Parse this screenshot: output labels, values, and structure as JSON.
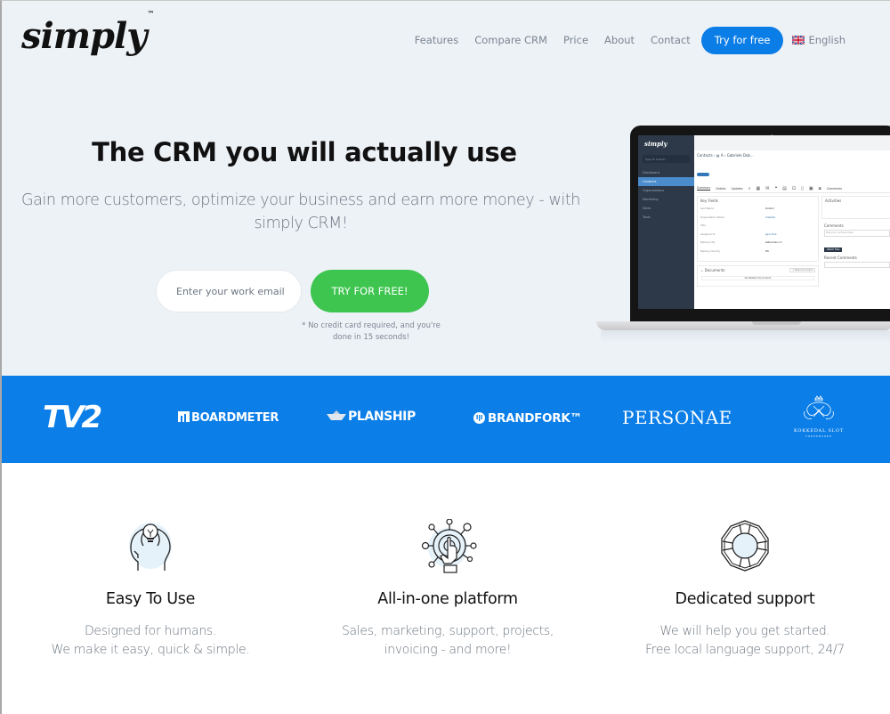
{
  "header": {
    "logo_text": "simply",
    "logo_tm": "™",
    "nav": [
      {
        "label": "Features"
      },
      {
        "label": "Compare CRM"
      },
      {
        "label": "Price"
      },
      {
        "label": "About"
      },
      {
        "label": "Contact"
      }
    ],
    "try_button": "Try for free",
    "language": {
      "label": "English",
      "flag_icon": "uk-flag-icon"
    }
  },
  "hero": {
    "title": "The CRM you will actually use",
    "subtitle": "Gain more customers, optimize your business and earn more money - with simply CRM!",
    "email_placeholder": "Enter your work email",
    "email_value": "",
    "cta_label": "TRY FOR FREE!",
    "note": "* No credit card required, and you're done in 15 seconds!"
  },
  "mockup": {
    "app_logo": "simply",
    "search_placeholder": "Type To Search...",
    "sidebar": [
      "Dashboard",
      "Contacts",
      "Organizations",
      "Marketing",
      "Sales",
      "Tools"
    ],
    "active_item": "Contacts",
    "breadcrumb": "Contacts › ▤ A › Gabriele Dob...",
    "tag": "+ Add Tag",
    "tabs": [
      "Summary",
      "Details",
      "Updates"
    ],
    "active_tab": "Summary",
    "key_fields_title": "Key Fields",
    "fields": [
      {
        "label": "Last Name",
        "value": "Dobom",
        "link": false
      },
      {
        "label": "Organization Name",
        "value": "Calexob",
        "link": true
      },
      {
        "label": "Title",
        "value": "",
        "link": false
      },
      {
        "label": "Assigned To",
        "value": "Jane Doe",
        "link": true
      },
      {
        "label": "Mailing City",
        "value": "København K",
        "link": false
      },
      {
        "label": "Mailing Country",
        "value": "DK",
        "link": false
      }
    ],
    "documents_title": "Documents",
    "new_document": "+ New Document",
    "no_documents": "No Related Documents",
    "activities_title": "Activities",
    "comments_title": "Comments",
    "comment_placeholder": "Post your comment here",
    "attach_files": "Attach Files",
    "recent_comments_title": "Recent Comments",
    "comments_tab": "Comments"
  },
  "logos": [
    {
      "name": "TV2",
      "text": "TV2"
    },
    {
      "name": "Boardmeter",
      "text": "BOARDMETER"
    },
    {
      "name": "Planship",
      "text": "PLANSHIP"
    },
    {
      "name": "Brandfork",
      "text": "BRANDFORK™"
    },
    {
      "name": "Personae",
      "text": "PERSONAE"
    },
    {
      "name": "Kokkedal Slot",
      "text": "KOKKEDAL SLOT",
      "sub": "COPENHAGEN"
    }
  ],
  "features": [
    {
      "icon": "lightbulb-head-icon",
      "title": "Easy To Use",
      "desc_line1": "Designed for humans.",
      "desc_line2": "We make it easy, quick & simple."
    },
    {
      "icon": "network-touch-icon",
      "title": "All-in-one platform",
      "desc_line1": "Sales, marketing, support, projects,",
      "desc_line2": "invoicing - and more!"
    },
    {
      "icon": "lifebuoy-icon",
      "title": "Dedicated support",
      "desc_line1": "We will help you get started.",
      "desc_line2": "Free local language support, 24/7"
    }
  ],
  "colors": {
    "hero_bg": "#edf2f7",
    "accent_blue": "#0a7de6",
    "cta_green": "#3ec54f",
    "band_blue": "#0b7ee8",
    "text_dark": "#111111",
    "text_muted": "#6c7680"
  }
}
